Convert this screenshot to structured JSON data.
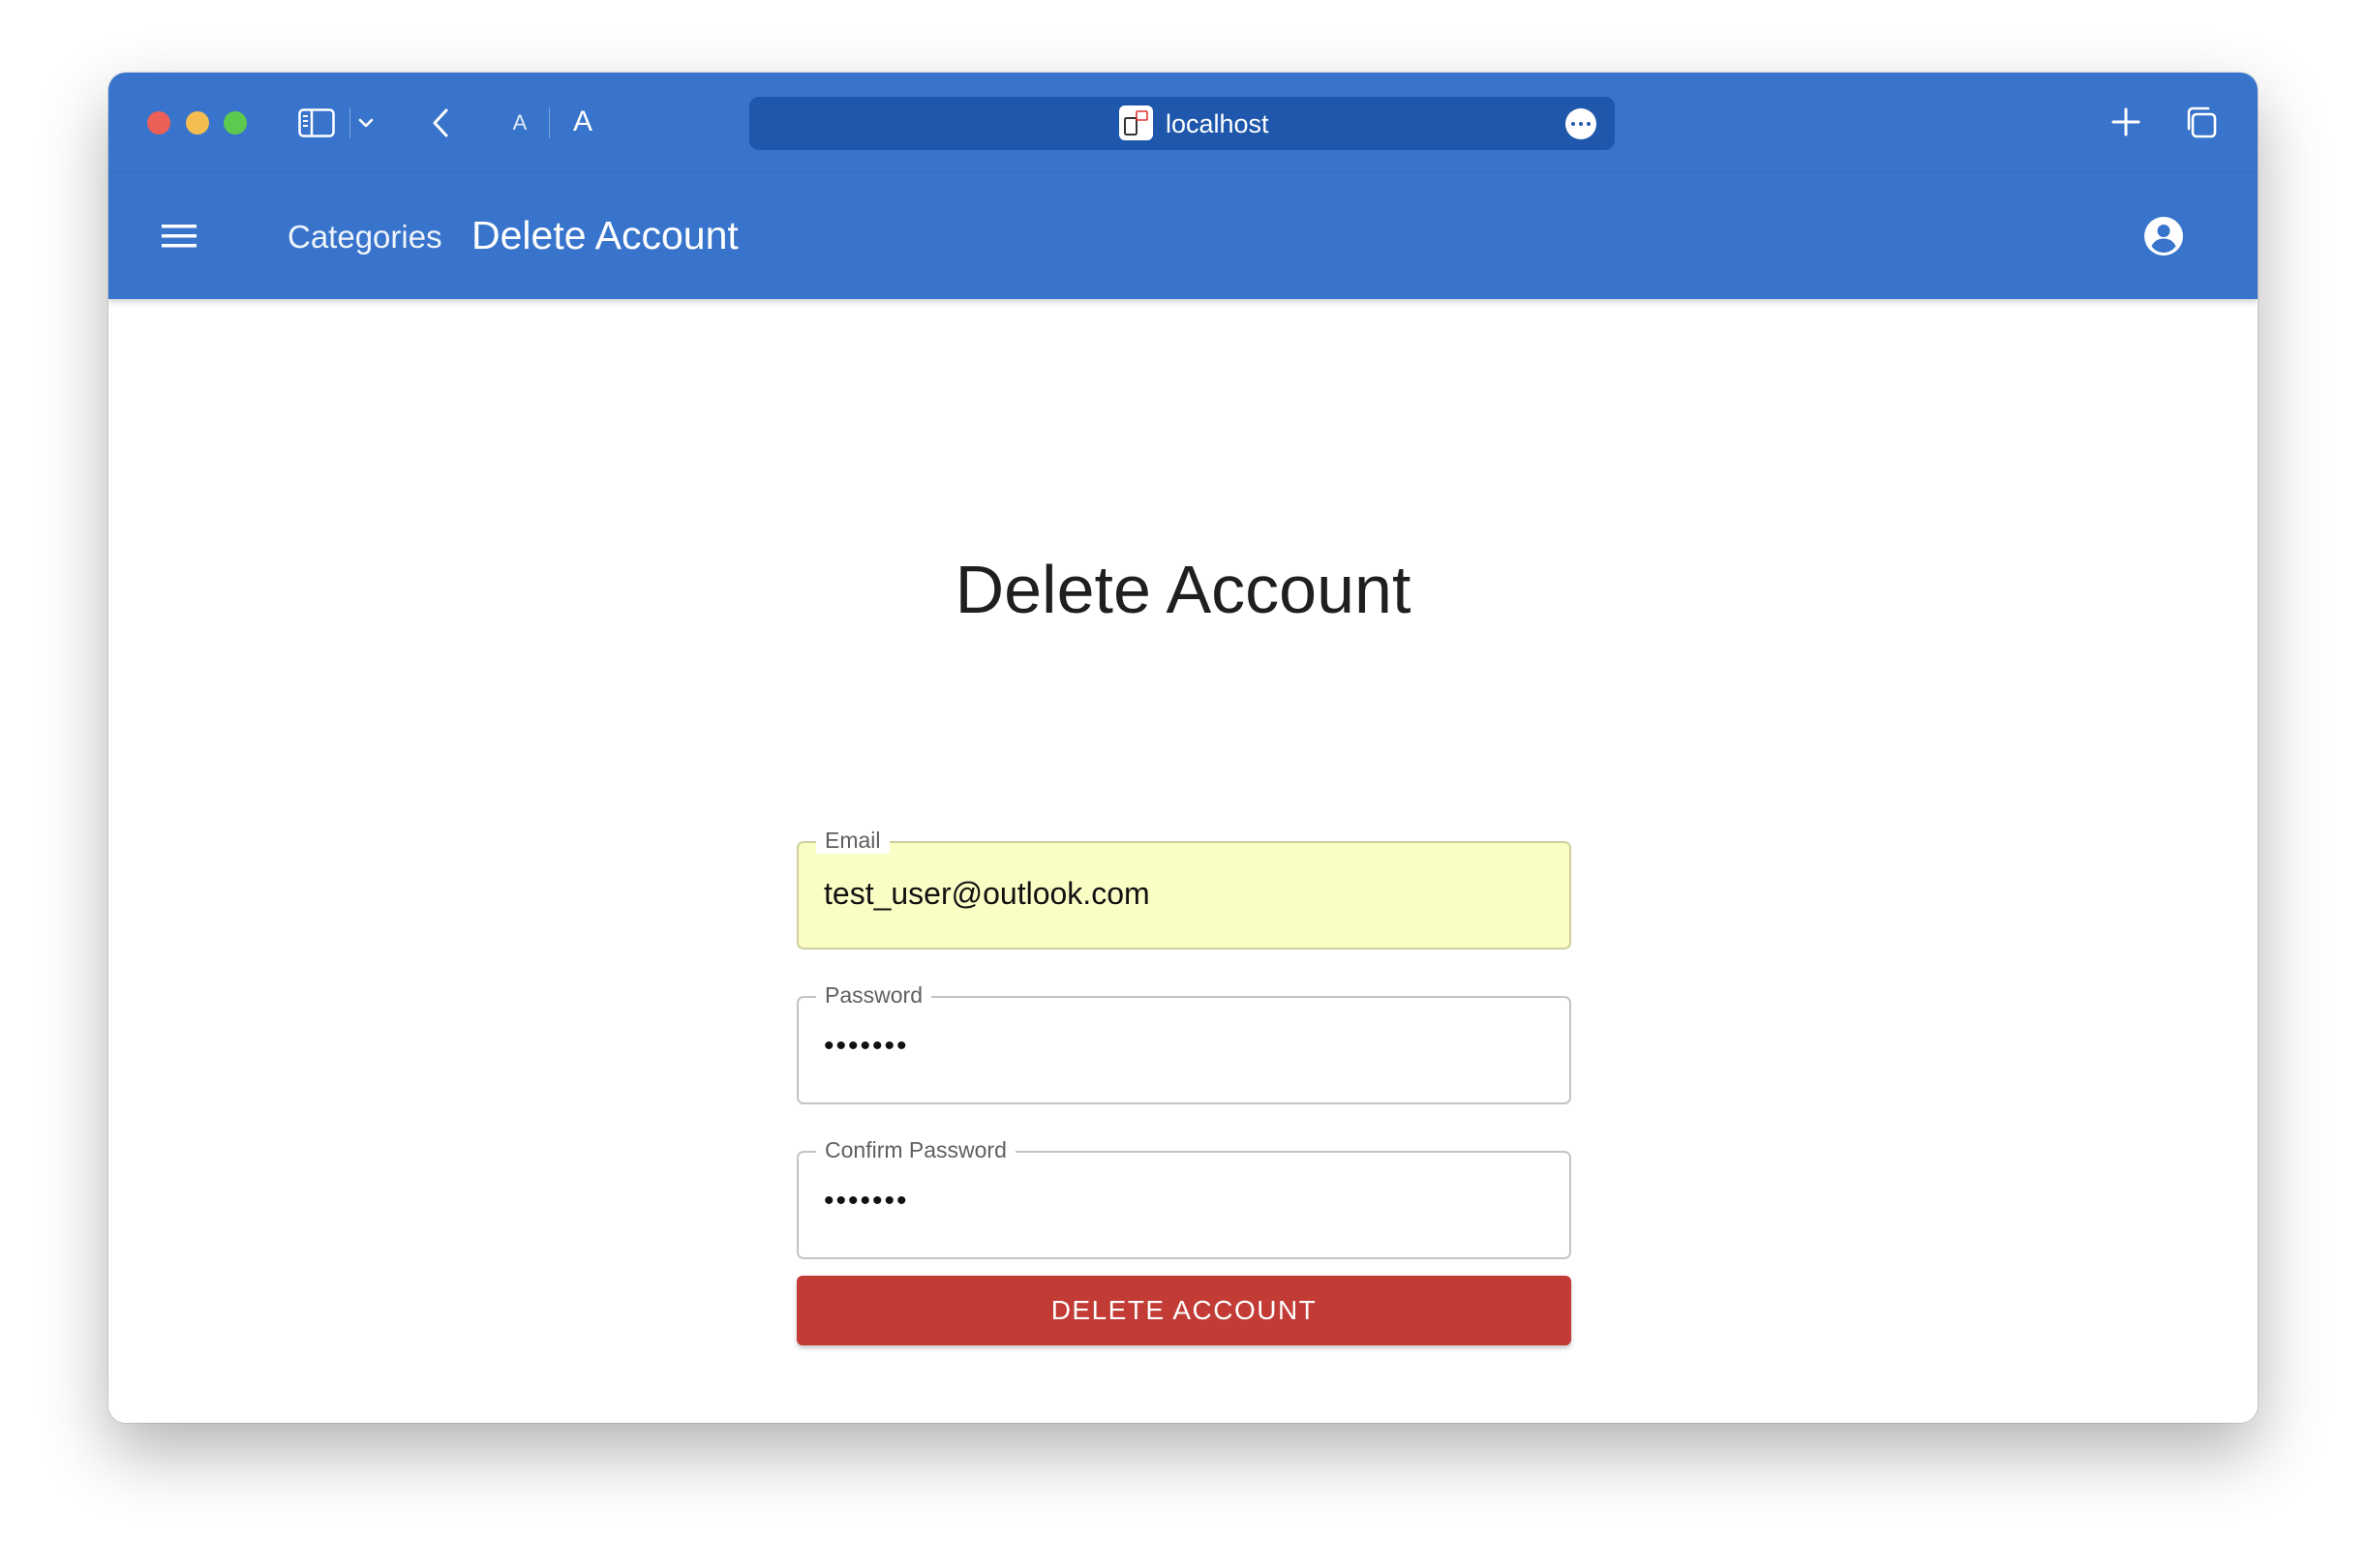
{
  "browser": {
    "url": "localhost",
    "font_small_label": "A",
    "font_large_label": "A"
  },
  "appbar": {
    "nav_link": "Categories",
    "title": "Delete Account"
  },
  "form": {
    "heading": "Delete Account",
    "email": {
      "label": "Email",
      "value": "test_user@outlook.com"
    },
    "password": {
      "label": "Password",
      "value": "•••••••"
    },
    "confirm_password": {
      "label": "Confirm Password",
      "value": "•••••••"
    },
    "submit_label": "DELETE ACCOUNT"
  },
  "colors": {
    "primary": "#3874cb",
    "url_bar": "#1e57ab",
    "danger": "#c23b35",
    "autofill": "#fafdc4"
  },
  "icons": [
    "sidebar-icon",
    "chevron-down-icon",
    "back-arrow-icon",
    "site-favicon-icon",
    "more-icon",
    "plus-icon",
    "tabs-icon",
    "menu-icon",
    "account-circle-icon"
  ]
}
